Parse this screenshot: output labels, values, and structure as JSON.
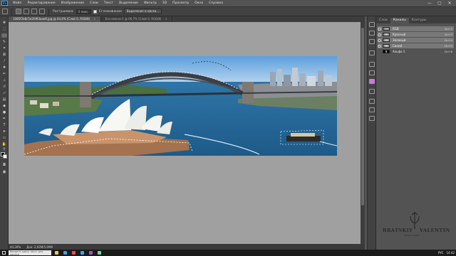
{
  "menubar": {
    "logo": "Ps",
    "items": [
      "Файл",
      "Редактирование",
      "Изображение",
      "Слои",
      "Текст",
      "Выделение",
      "Фильтр",
      "3D",
      "Просмотр",
      "Окно",
      "Справка"
    ]
  },
  "window_controls": {
    "minimize": "—",
    "maximize": "▢",
    "close": "✕"
  },
  "optionsbar": {
    "feather_label": "Растушевка:",
    "feather_value": "0 пикс.",
    "antialias_label": "Сглаживание",
    "select_mask_button": "Выделение и маска..."
  },
  "tabs": [
    {
      "label": "1085f2b8c5e2fd93aae6.jpg @ 44,4% (Слой 0, RGB/8)",
      "close": "×"
    },
    {
      "label": "Без имени-1 @ 66,7% (Слой 0, RGB/8)",
      "close": "×"
    }
  ],
  "status": {
    "zoom": "44,39%",
    "doc": "Док: 2,92M/5,09M"
  },
  "panel": {
    "tabs": [
      "Слои",
      "Каналы",
      "Контуры"
    ],
    "channels": [
      {
        "name": "RGB",
        "shortcut": "Ctrl+2",
        "thumb": "color",
        "visible": true
      },
      {
        "name": "Красный",
        "shortcut": "Ctrl+3",
        "thumb": "gray",
        "visible": true
      },
      {
        "name": "Зеленый",
        "shortcut": "Ctrl+4",
        "thumb": "gray",
        "visible": true
      },
      {
        "name": "Синий",
        "shortcut": "Ctrl+5",
        "thumb": "gray",
        "visible": true
      },
      {
        "name": "Альфа 1",
        "shortcut": "Ctrl+6",
        "thumb": "alpha",
        "visible": false
      }
    ]
  },
  "watermark": {
    "left": "BRATSKIY",
    "right": "VALENTIN",
    "sub": "graphic design"
  },
  "taskbar": {
    "search_placeholder": "Введите здесь текст для поиска",
    "lang": "РУС",
    "time": "14:42"
  },
  "colors": {
    "accent": "#31a8ff",
    "panel": "#535353",
    "workspace": "#a0a0a0"
  }
}
